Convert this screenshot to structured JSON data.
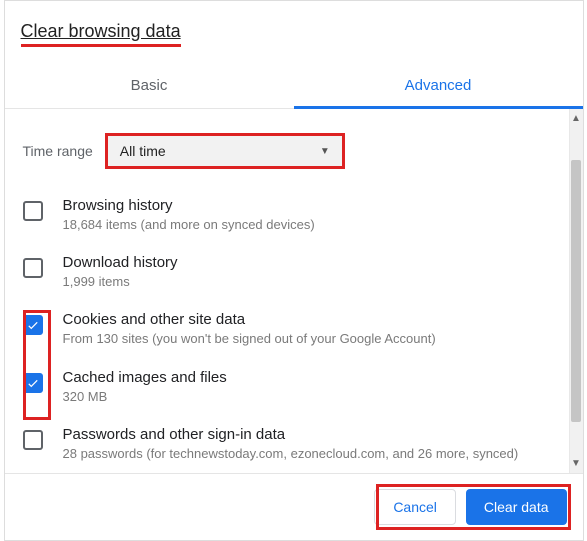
{
  "dialog": {
    "title": "Clear browsing data"
  },
  "tabs": {
    "basic": "Basic",
    "advanced": "Advanced"
  },
  "timerange": {
    "label": "Time range",
    "selected": "All time"
  },
  "items": [
    {
      "title": "Browsing history",
      "sub": "18,684 items (and more on synced devices)",
      "checked": false
    },
    {
      "title": "Download history",
      "sub": "1,999 items",
      "checked": false
    },
    {
      "title": "Cookies and other site data",
      "sub": "From 130 sites (you won't be signed out of your Google Account)",
      "checked": true
    },
    {
      "title": "Cached images and files",
      "sub": "320 MB",
      "checked": true
    },
    {
      "title": "Passwords and other sign-in data",
      "sub": "28 passwords (for technewstoday.com, ezonecloud.com, and 26 more, synced)",
      "checked": false
    }
  ],
  "footer": {
    "cancel": "Cancel",
    "clear": "Clear data"
  }
}
